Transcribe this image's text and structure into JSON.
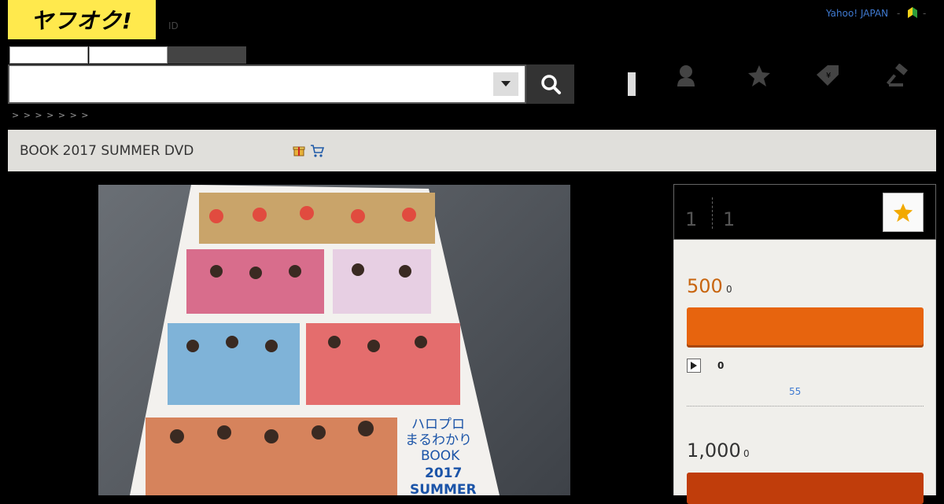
{
  "header": {
    "logo_text": "ヤフオク!",
    "id_label": "ID",
    "yahoo_link": "Yahoo! JAPAN",
    "separator": "-",
    "search": {
      "placeholder": ""
    },
    "tabs": [
      "",
      "",
      ""
    ]
  },
  "breadcrumb": "> >    > > > >    >",
  "item": {
    "title": "BOOK 2017 SUMMER DVD"
  },
  "panel": {
    "count_left": "1",
    "count_right": "1",
    "current_price": "500",
    "current_price_unit": "0",
    "bids": "0",
    "time_left": "55",
    "buyout_price": "1,000",
    "buyout_price_unit": "0"
  },
  "icons": {
    "search": "search-icon",
    "user": "user-icon",
    "star": "star-icon",
    "tag": "tag-icon",
    "gavel": "gavel-icon",
    "watch": "star-icon",
    "beginner": "beginner-mark-icon"
  },
  "colors": {
    "accent_orange": "#e7640e",
    "buyout_red": "#c03d0b",
    "logo_yellow": "#ffe94d",
    "link_blue": "#3f7ad1"
  }
}
